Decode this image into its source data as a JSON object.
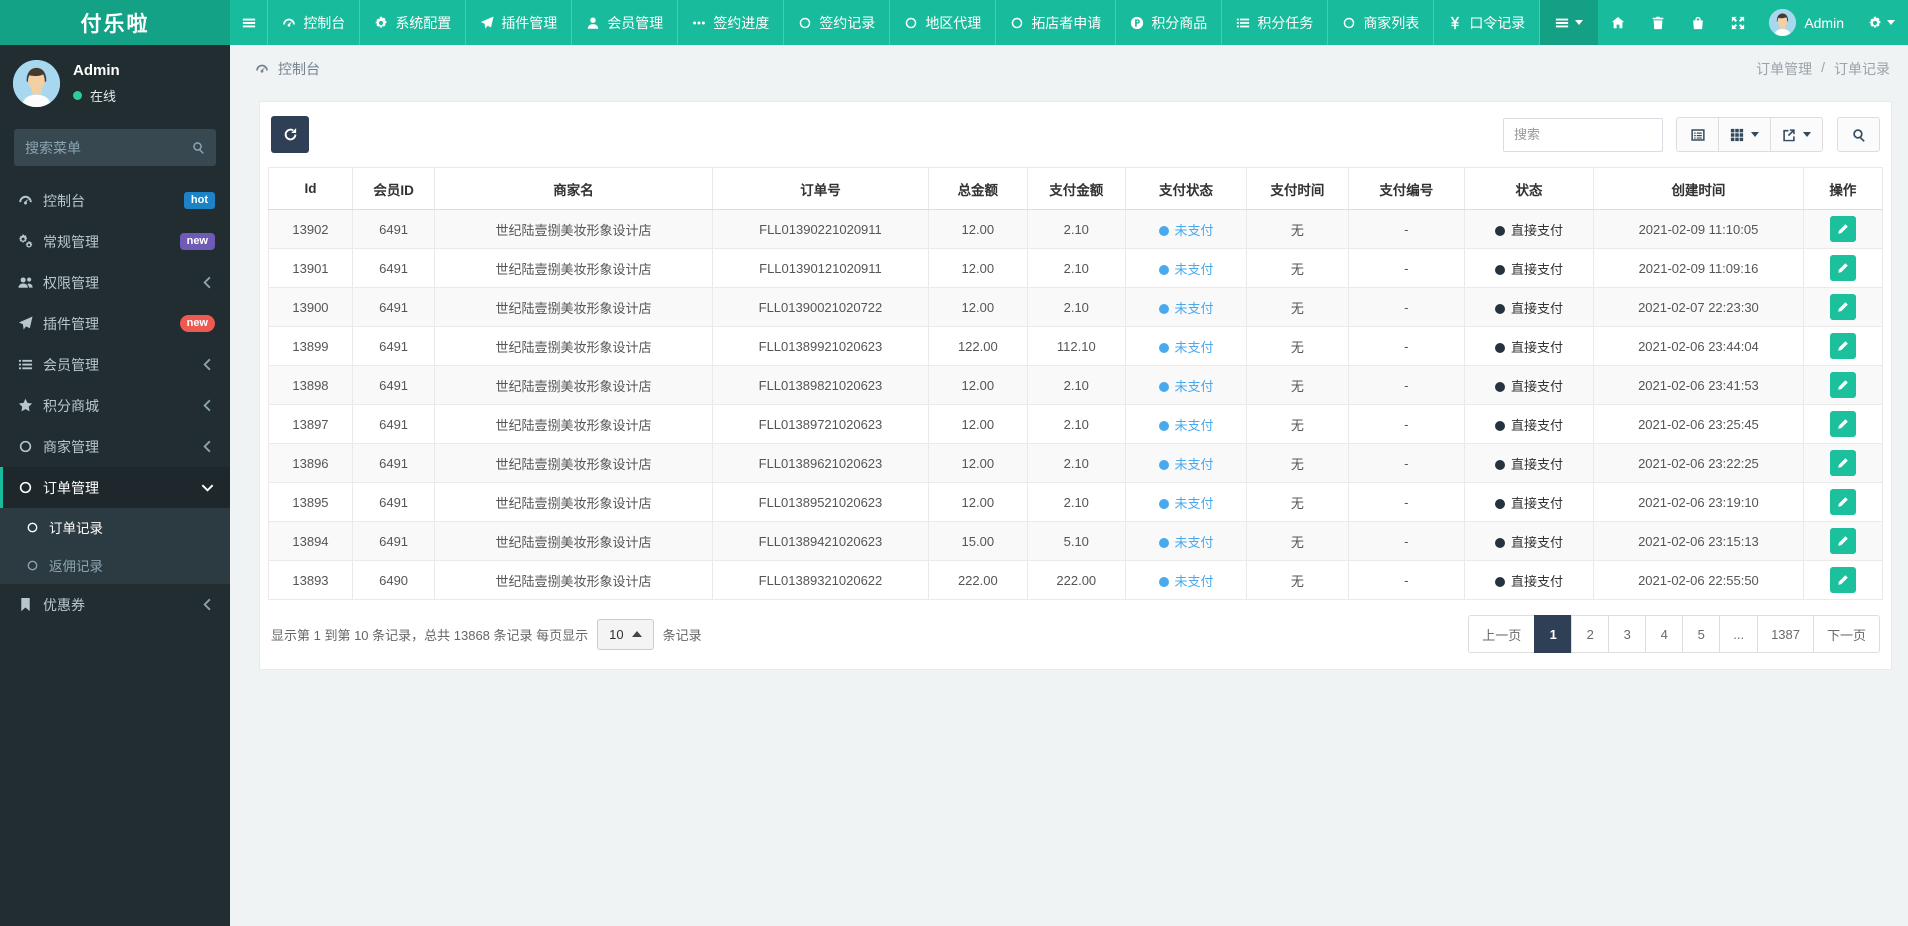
{
  "brand": "付乐啦",
  "colors": {
    "navbar": "#18bc9c",
    "brand_bg": "#14a286",
    "sidebar": "#222d32",
    "dark_button": "#2f4056",
    "badge_hot": "#1c84c6",
    "badge_new_purple": "#6f5bb5",
    "badge_new_red": "#ee5a52",
    "pay_status_blue": "#49a9ee",
    "edit_button_green": "#1cc09c",
    "online_dot": "#2ecc9a"
  },
  "navbar": {
    "username": "Admin",
    "menu": [
      {
        "label": "控制台",
        "icon": "dashboard-icon"
      },
      {
        "label": "系统配置",
        "icon": "gear-icon"
      },
      {
        "label": "插件管理",
        "icon": "paper-plane-icon"
      },
      {
        "label": "会员管理",
        "icon": "user-icon"
      },
      {
        "label": "签约进度",
        "icon": "ellipsis-icon"
      },
      {
        "label": "签约记录",
        "icon": "circle-icon"
      },
      {
        "label": "地区代理",
        "icon": "circle-icon"
      },
      {
        "label": "拓店者申请",
        "icon": "circle-icon"
      },
      {
        "label": "积分商品",
        "icon": "points-coin-icon"
      },
      {
        "label": "积分任务",
        "icon": "list-icon"
      },
      {
        "label": "商家列表",
        "icon": "circle-icon"
      },
      {
        "label": "口令记录",
        "icon": "yen-icon"
      }
    ]
  },
  "sidebar": {
    "user": {
      "name": "Admin",
      "status": "在线"
    },
    "search_placeholder": "搜索菜单",
    "menu": [
      {
        "label": "控制台",
        "icon": "dashboard-icon",
        "badge": "hot",
        "badge_style": "hot"
      },
      {
        "label": "常规管理",
        "icon": "gears-icon",
        "badge": "new",
        "badge_style": "new-purple"
      },
      {
        "label": "权限管理",
        "icon": "users-icon",
        "chevron": true
      },
      {
        "label": "插件管理",
        "icon": "paper-plane-icon",
        "badge": "new",
        "badge_style": "new-red"
      },
      {
        "label": "会员管理",
        "icon": "list-icon",
        "chevron": true
      },
      {
        "label": "积分商城",
        "icon": "star-icon",
        "chevron": true
      },
      {
        "label": "商家管理",
        "icon": "circle-icon",
        "chevron": true
      },
      {
        "label": "订单管理",
        "icon": "circle-icon",
        "active": true,
        "expanded": true,
        "children": [
          {
            "label": "订单记录",
            "icon": "circle-icon",
            "active": true
          },
          {
            "label": "返佣记录",
            "icon": "circle-icon"
          }
        ]
      },
      {
        "label": "优惠券",
        "icon": "bookmark-icon",
        "chevron": true
      }
    ]
  },
  "breadcrumb": {
    "section": "控制台",
    "trail_parent": "订单管理",
    "trail_sep": "/",
    "trail_current": "订单记录"
  },
  "toolbar": {
    "search_placeholder": "搜索"
  },
  "table": {
    "columns": [
      "Id",
      "会员ID",
      "商家名",
      "订单号",
      "总金额",
      "支付金额",
      "支付状态",
      "支付时间",
      "支付编号",
      "状态",
      "创建时间",
      "操作"
    ],
    "rows": [
      {
        "id": "13902",
        "member_id": "6491",
        "merchant": "世纪陆壹捌美妆形象设计店",
        "order_no": "FLL01390221020911",
        "total": "12.00",
        "paid": "2.10",
        "pay_status": "未支付",
        "pay_time": "无",
        "pay_no": "-",
        "status": "直接支付",
        "created": "2021-02-09 11:10:05"
      },
      {
        "id": "13901",
        "member_id": "6491",
        "merchant": "世纪陆壹捌美妆形象设计店",
        "order_no": "FLL01390121020911",
        "total": "12.00",
        "paid": "2.10",
        "pay_status": "未支付",
        "pay_time": "无",
        "pay_no": "-",
        "status": "直接支付",
        "created": "2021-02-09 11:09:16"
      },
      {
        "id": "13900",
        "member_id": "6491",
        "merchant": "世纪陆壹捌美妆形象设计店",
        "order_no": "FLL01390021020722",
        "total": "12.00",
        "paid": "2.10",
        "pay_status": "未支付",
        "pay_time": "无",
        "pay_no": "-",
        "status": "直接支付",
        "created": "2021-02-07 22:23:30"
      },
      {
        "id": "13899",
        "member_id": "6491",
        "merchant": "世纪陆壹捌美妆形象设计店",
        "order_no": "FLL01389921020623",
        "total": "122.00",
        "paid": "112.10",
        "pay_status": "未支付",
        "pay_time": "无",
        "pay_no": "-",
        "status": "直接支付",
        "created": "2021-02-06 23:44:04"
      },
      {
        "id": "13898",
        "member_id": "6491",
        "merchant": "世纪陆壹捌美妆形象设计店",
        "order_no": "FLL01389821020623",
        "total": "12.00",
        "paid": "2.10",
        "pay_status": "未支付",
        "pay_time": "无",
        "pay_no": "-",
        "status": "直接支付",
        "created": "2021-02-06 23:41:53"
      },
      {
        "id": "13897",
        "member_id": "6491",
        "merchant": "世纪陆壹捌美妆形象设计店",
        "order_no": "FLL01389721020623",
        "total": "12.00",
        "paid": "2.10",
        "pay_status": "未支付",
        "pay_time": "无",
        "pay_no": "-",
        "status": "直接支付",
        "created": "2021-02-06 23:25:45"
      },
      {
        "id": "13896",
        "member_id": "6491",
        "merchant": "世纪陆壹捌美妆形象设计店",
        "order_no": "FLL01389621020623",
        "total": "12.00",
        "paid": "2.10",
        "pay_status": "未支付",
        "pay_time": "无",
        "pay_no": "-",
        "status": "直接支付",
        "created": "2021-02-06 23:22:25"
      },
      {
        "id": "13895",
        "member_id": "6491",
        "merchant": "世纪陆壹捌美妆形象设计店",
        "order_no": "FLL01389521020623",
        "total": "12.00",
        "paid": "2.10",
        "pay_status": "未支付",
        "pay_time": "无",
        "pay_no": "-",
        "status": "直接支付",
        "created": "2021-02-06 23:19:10"
      },
      {
        "id": "13894",
        "member_id": "6491",
        "merchant": "世纪陆壹捌美妆形象设计店",
        "order_no": "FLL01389421020623",
        "total": "15.00",
        "paid": "5.10",
        "pay_status": "未支付",
        "pay_time": "无",
        "pay_no": "-",
        "status": "直接支付",
        "created": "2021-02-06 23:15:13"
      },
      {
        "id": "13893",
        "member_id": "6490",
        "merchant": "世纪陆壹捌美妆形象设计店",
        "order_no": "FLL01389321020622",
        "total": "222.00",
        "paid": "222.00",
        "pay_status": "未支付",
        "pay_time": "无",
        "pay_no": "-",
        "status": "直接支付",
        "created": "2021-02-06 22:55:50"
      }
    ]
  },
  "footer": {
    "summary_prefix": "显示第 1 到第 10 条记录，总共 13868 条记录 每页显示",
    "page_size": "10",
    "summary_suffix": "条记录",
    "pagination": [
      {
        "label": "上一页"
      },
      {
        "label": "1",
        "active": true
      },
      {
        "label": "2"
      },
      {
        "label": "3"
      },
      {
        "label": "4"
      },
      {
        "label": "5"
      },
      {
        "label": "..."
      },
      {
        "label": "1387"
      },
      {
        "label": "下一页"
      }
    ]
  }
}
